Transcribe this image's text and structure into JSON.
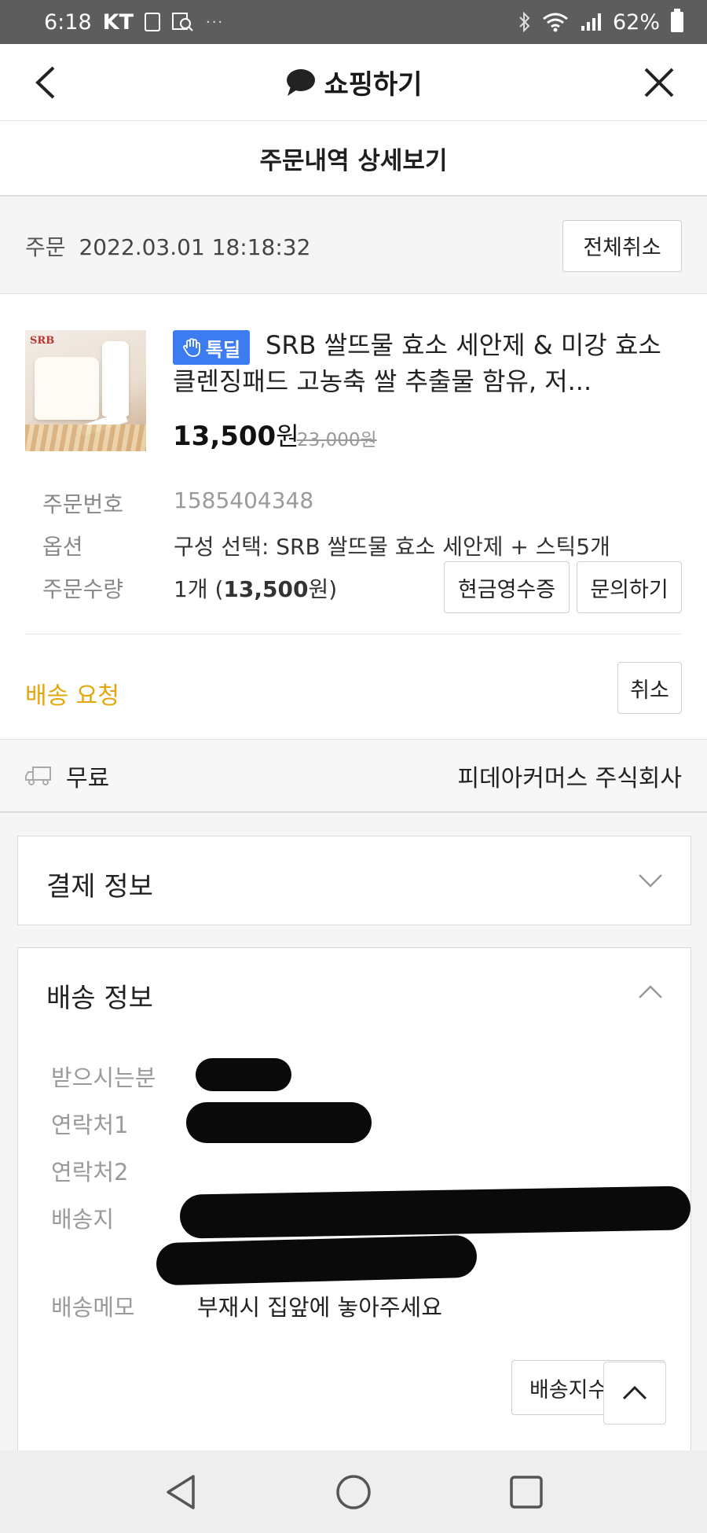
{
  "status_bar": {
    "time": "6:18",
    "carrier": "KT",
    "battery": "62%"
  },
  "header": {
    "title": "쇼핑하기"
  },
  "subtitle": "주문내역 상세보기",
  "order": {
    "date_label": "주문",
    "date_value": "2022.03.01 18:18:32",
    "cancel_all_label": "전체취소"
  },
  "product": {
    "image_brand": "SRB",
    "badge_label": "톡딜",
    "name": "SRB 쌀뜨물 효소 세안제 & 미강 효소 클렌징패드 고농축 쌀 추출물 함유, 저...",
    "price": "13,500",
    "price_unit": "원",
    "original_price": "23,000원",
    "order_number_label": "주문번호",
    "order_number": "1585404348",
    "option_label": "옵션",
    "option_value": "구성 선택: SRB 쌀뜨물 효소 세안제 + 스틱5개",
    "quantity_label": "주문수량",
    "quantity_count": "1개 (",
    "quantity_amount": "13,500",
    "quantity_suffix": "원)",
    "receipt_button": "현금영수증",
    "inquiry_button": "문의하기",
    "shipping_status": "배송 요청",
    "cancel_button": "취소"
  },
  "delivery_fee": {
    "fee": "무료",
    "seller": "피데아커머스 주식회사"
  },
  "payment_info": {
    "title": "결제 정보",
    "expanded": false
  },
  "delivery_info": {
    "title": "배송 정보",
    "expanded": true,
    "recipient_label": "받으시는분",
    "contact1_label": "연락처1",
    "contact2_label": "연락처2",
    "address_label": "배송지",
    "memo_label": "배송메모",
    "memo_value": "부재시 집앞에 놓아주세요",
    "change_address_button": "배송지수정"
  },
  "colors": {
    "accent_yellow": "#e5a60b",
    "badge_blue": "#3c7bf0",
    "status_bar": "#5d5d5d"
  },
  "icons": [
    "back-arrow-icon",
    "chat-bubble-icon",
    "close-icon",
    "waving-hand-icon",
    "truck-icon",
    "chevron-down-icon",
    "chevron-up-icon",
    "nav-back-icon",
    "nav-home-icon",
    "nav-recents-icon"
  ]
}
